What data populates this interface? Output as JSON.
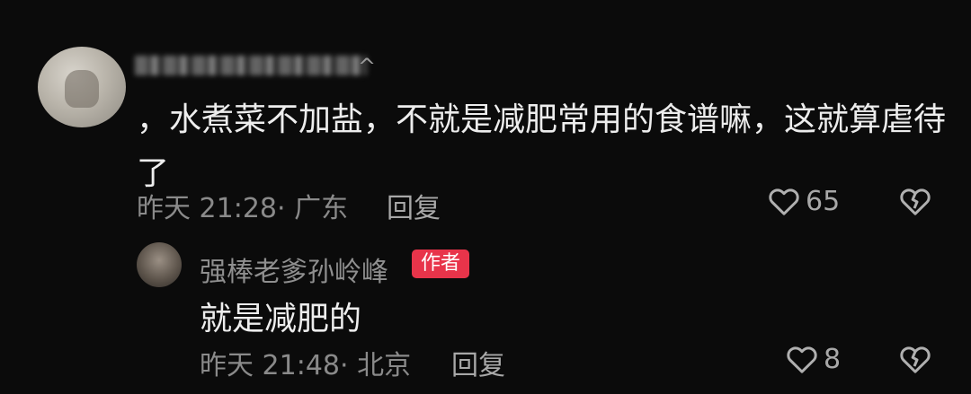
{
  "comment": {
    "text": "，水煮菜不加盐，不就是减肥常用的食谱嘛，这就算虐待了",
    "meta": "昨天 21:28· 广东",
    "reply_label": "回复",
    "likes": "65"
  },
  "reply": {
    "username": "强棒老爹孙岭峰",
    "badge": "作者",
    "text": "就是减肥的",
    "meta": "昨天 21:48· 北京",
    "reply_label": "回复",
    "likes": "8"
  },
  "colors": {
    "background": "#0b0b0b",
    "badge": "#e8344a",
    "text": "#ededed",
    "muted": "#8a8a8a"
  },
  "icons": {
    "like": "heart-outline-icon",
    "dislike": "broken-heart-icon"
  }
}
